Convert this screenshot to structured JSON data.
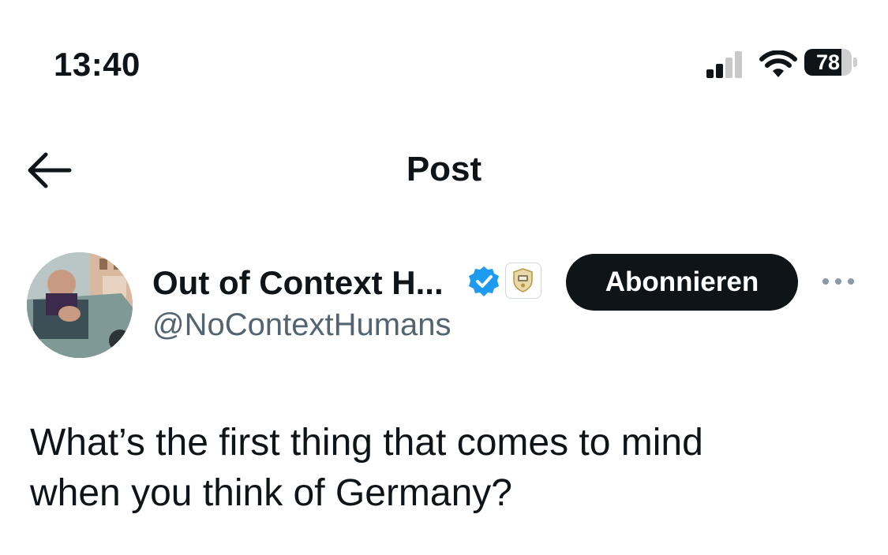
{
  "status_bar": {
    "time": "13:40",
    "battery_level": "78",
    "battery_fraction": 0.78,
    "icons": [
      "signal-icon",
      "wifi-icon",
      "battery-icon"
    ]
  },
  "header": {
    "title": "Post",
    "back_icon": "arrow-left-icon"
  },
  "author": {
    "display_name": "Out of Context H...",
    "handle": "@NoContextHumans",
    "verified_icon": "verified-badge-icon",
    "affiliate_icon": "affiliate-badge-icon",
    "subscribe_label": "Abonnieren",
    "more_icon": "more-dots-icon"
  },
  "post": {
    "text_line1": "What’s the first thing that comes to mind",
    "text_line2": "when you think of Germany?"
  },
  "colors": {
    "text": "#0f1419",
    "secondary": "#536471",
    "verified_blue": "#1d9bf0",
    "button_bg": "#0f1419"
  }
}
